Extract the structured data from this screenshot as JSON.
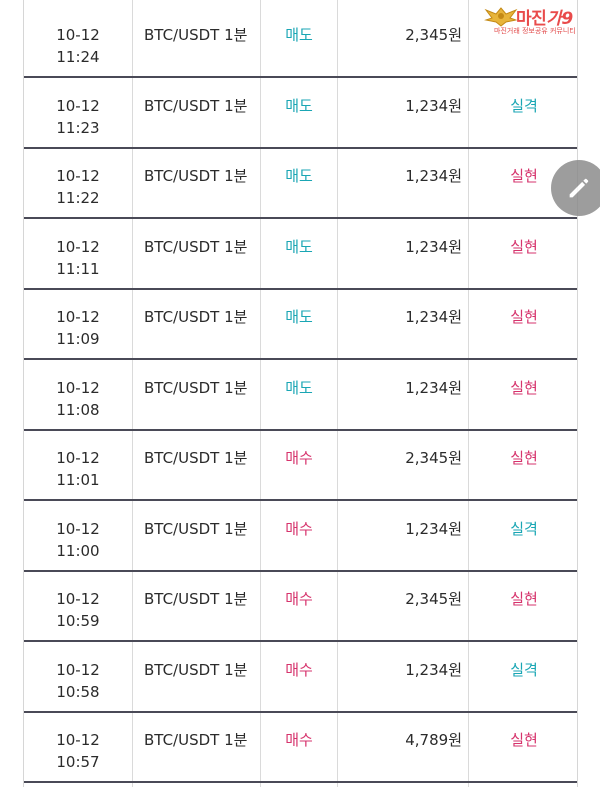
{
  "logo": {
    "title": "마진",
    "title_suffix": "가9",
    "subtitle": "마진거래 정보공유 커뮤니티"
  },
  "rows": [
    {
      "date": "10-12",
      "time": "11:24",
      "symbol": "BTC/USDT 1분",
      "side": "매도",
      "side_color": "#1aa6b4",
      "amount": "2,345원",
      "result": "",
      "result_color": ""
    },
    {
      "date": "10-12",
      "time": "11:23",
      "symbol": "BTC/USDT 1분",
      "side": "매도",
      "side_color": "#1aa6b4",
      "amount": "1,234원",
      "result": "실격",
      "result_color": "#1aa6b4"
    },
    {
      "date": "10-12",
      "time": "11:22",
      "symbol": "BTC/USDT 1분",
      "side": "매도",
      "side_color": "#1aa6b4",
      "amount": "1,234원",
      "result": "실현",
      "result_color": "#d6336c"
    },
    {
      "date": "10-12",
      "time": "11:11",
      "symbol": "BTC/USDT 1분",
      "side": "매도",
      "side_color": "#1aa6b4",
      "amount": "1,234원",
      "result": "실현",
      "result_color": "#d6336c"
    },
    {
      "date": "10-12",
      "time": "11:09",
      "symbol": "BTC/USDT 1분",
      "side": "매도",
      "side_color": "#1aa6b4",
      "amount": "1,234원",
      "result": "실현",
      "result_color": "#d6336c"
    },
    {
      "date": "10-12",
      "time": "11:08",
      "symbol": "BTC/USDT 1분",
      "side": "매도",
      "side_color": "#1aa6b4",
      "amount": "1,234원",
      "result": "실현",
      "result_color": "#d6336c"
    },
    {
      "date": "10-12",
      "time": "11:01",
      "symbol": "BTC/USDT 1분",
      "side": "매수",
      "side_color": "#d6336c",
      "amount": "2,345원",
      "result": "실현",
      "result_color": "#d6336c"
    },
    {
      "date": "10-12",
      "time": "11:00",
      "symbol": "BTC/USDT 1분",
      "side": "매수",
      "side_color": "#d6336c",
      "amount": "1,234원",
      "result": "실격",
      "result_color": "#1aa6b4"
    },
    {
      "date": "10-12",
      "time": "10:59",
      "symbol": "BTC/USDT 1분",
      "side": "매수",
      "side_color": "#d6336c",
      "amount": "2,345원",
      "result": "실현",
      "result_color": "#d6336c"
    },
    {
      "date": "10-12",
      "time": "10:58",
      "symbol": "BTC/USDT 1분",
      "side": "매수",
      "side_color": "#d6336c",
      "amount": "1,234원",
      "result": "실격",
      "result_color": "#1aa6b4"
    },
    {
      "date": "10-12",
      "time": "10:57",
      "symbol": "BTC/USDT 1분",
      "side": "매수",
      "side_color": "#d6336c",
      "amount": "4,789원",
      "result": "실현",
      "result_color": "#d6336c"
    }
  ],
  "fab": {
    "icon": "pencil-icon"
  }
}
